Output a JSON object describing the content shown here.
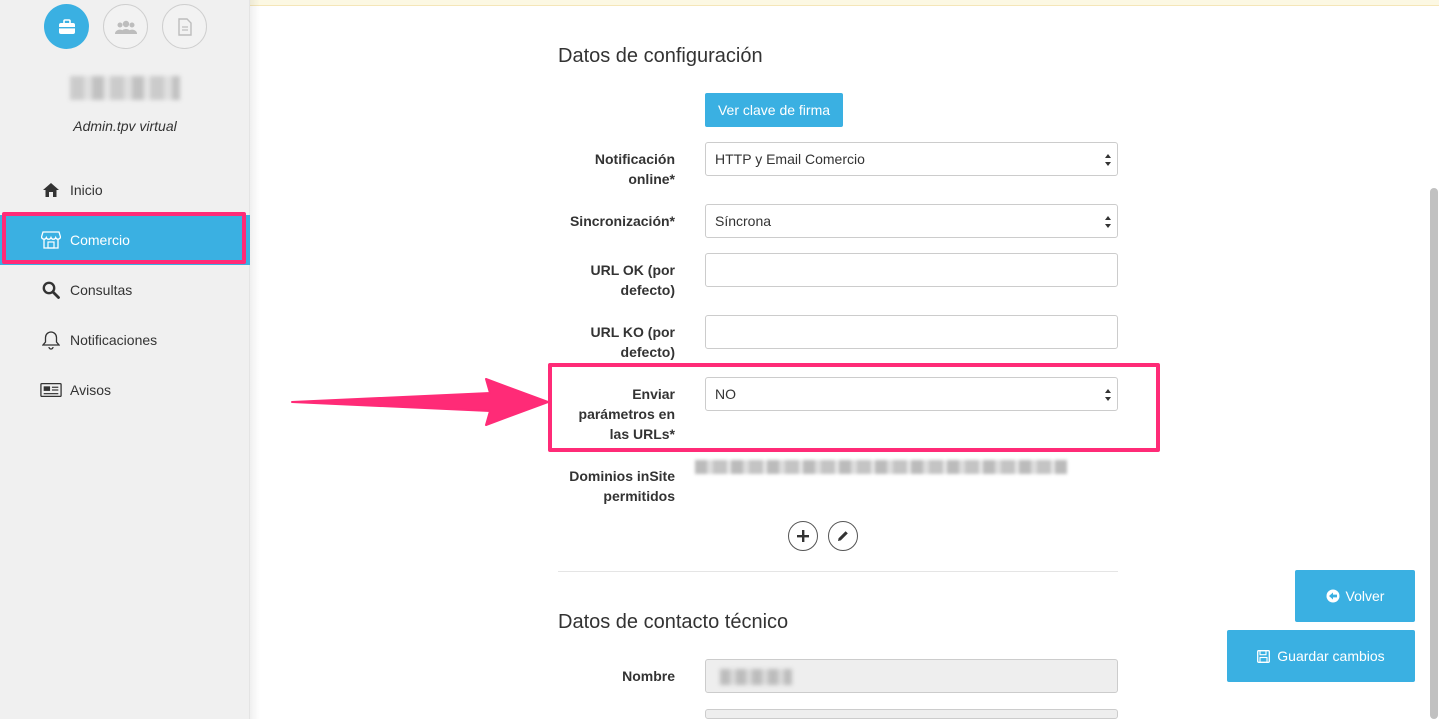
{
  "sidebar": {
    "role": "Admin.tpv virtual",
    "top_icons": [
      {
        "icon": "briefcase-icon",
        "active": true
      },
      {
        "icon": "users-icon",
        "active": false
      },
      {
        "icon": "document-icon",
        "active": false
      }
    ],
    "nav": [
      {
        "label": "Inicio",
        "icon": "home-icon"
      },
      {
        "label": "Comercio",
        "icon": "store-icon",
        "active": true
      },
      {
        "label": "Consultas",
        "icon": "search-icon"
      },
      {
        "label": "Notificaciones",
        "icon": "bell-icon"
      },
      {
        "label": "Avisos",
        "icon": "newspaper-icon"
      }
    ]
  },
  "config": {
    "title": "Datos de configuración",
    "show_key_button": "Ver clave de firma",
    "notificacion_label_1": "Notificación",
    "notificacion_label_2": "online*",
    "notificacion_value": "HTTP y Email Comercio",
    "sincronizacion_label": "Sincronización*",
    "sincronizacion_value": "Síncrona",
    "url_ok_label_1": "URL OK (por",
    "url_ok_label_2": "defecto)",
    "url_ok_value": "",
    "url_ko_label_1": "URL KO (por",
    "url_ko_label_2": "defecto)",
    "url_ko_value": "",
    "enviar_label_1": "Enviar",
    "enviar_label_2": "parámetros en",
    "enviar_label_3": "las URLs*",
    "enviar_value": "NO",
    "dominios_label_1": "Dominios inSite",
    "dominios_label_2": "permitidos"
  },
  "contact": {
    "title": "Datos de contacto técnico",
    "nombre_label": "Nombre"
  },
  "actions": {
    "back_label": "Volver",
    "save_label": "Guardar cambios"
  },
  "colors": {
    "accent": "#3ab0e2",
    "highlight": "#ff2b77"
  }
}
